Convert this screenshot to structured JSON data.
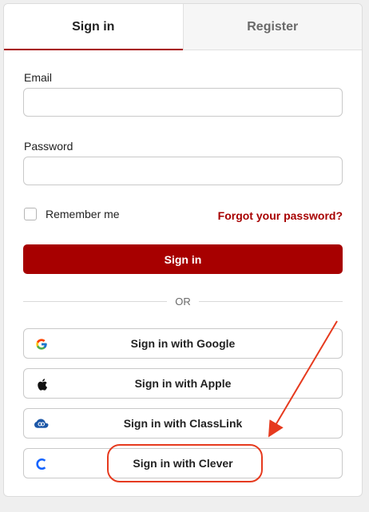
{
  "tabs": [
    {
      "label": "Sign in",
      "active": true
    },
    {
      "label": "Register",
      "active": false
    }
  ],
  "form": {
    "email_label": "Email",
    "email_value": "",
    "password_label": "Password",
    "password_value": "",
    "remember_label": "Remember me",
    "remember_checked": false,
    "forgot_label": "Forgot your password?",
    "submit_label": "Sign in",
    "divider_label": "OR"
  },
  "social": [
    {
      "label": "Sign in with Google",
      "icon": "google-icon"
    },
    {
      "label": "Sign in with Apple",
      "icon": "apple-icon"
    },
    {
      "label": "Sign in with ClassLink",
      "icon": "classlink-icon"
    },
    {
      "label": "Sign in with Clever",
      "icon": "clever-icon"
    }
  ],
  "colors": {
    "brand": "#a70000",
    "annotation": "#e63a1e",
    "google_blue": "#4285F4",
    "classlink_blue": "#1c57a7",
    "clever_blue": "#1464ff"
  }
}
